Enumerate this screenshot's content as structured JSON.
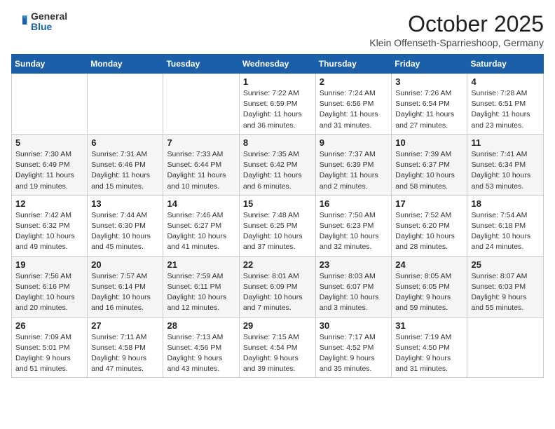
{
  "header": {
    "logo_general": "General",
    "logo_blue": "Blue",
    "month_title": "October 2025",
    "subtitle": "Klein Offenseth-Sparrieshoop, Germany"
  },
  "weekdays": [
    "Sunday",
    "Monday",
    "Tuesday",
    "Wednesday",
    "Thursday",
    "Friday",
    "Saturday"
  ],
  "weeks": [
    [
      {
        "day": "",
        "info": ""
      },
      {
        "day": "",
        "info": ""
      },
      {
        "day": "",
        "info": ""
      },
      {
        "day": "1",
        "info": "Sunrise: 7:22 AM\nSunset: 6:59 PM\nDaylight: 11 hours\nand 36 minutes."
      },
      {
        "day": "2",
        "info": "Sunrise: 7:24 AM\nSunset: 6:56 PM\nDaylight: 11 hours\nand 31 minutes."
      },
      {
        "day": "3",
        "info": "Sunrise: 7:26 AM\nSunset: 6:54 PM\nDaylight: 11 hours\nand 27 minutes."
      },
      {
        "day": "4",
        "info": "Sunrise: 7:28 AM\nSunset: 6:51 PM\nDaylight: 11 hours\nand 23 minutes."
      }
    ],
    [
      {
        "day": "5",
        "info": "Sunrise: 7:30 AM\nSunset: 6:49 PM\nDaylight: 11 hours\nand 19 minutes."
      },
      {
        "day": "6",
        "info": "Sunrise: 7:31 AM\nSunset: 6:46 PM\nDaylight: 11 hours\nand 15 minutes."
      },
      {
        "day": "7",
        "info": "Sunrise: 7:33 AM\nSunset: 6:44 PM\nDaylight: 11 hours\nand 10 minutes."
      },
      {
        "day": "8",
        "info": "Sunrise: 7:35 AM\nSunset: 6:42 PM\nDaylight: 11 hours\nand 6 minutes."
      },
      {
        "day": "9",
        "info": "Sunrise: 7:37 AM\nSunset: 6:39 PM\nDaylight: 11 hours\nand 2 minutes."
      },
      {
        "day": "10",
        "info": "Sunrise: 7:39 AM\nSunset: 6:37 PM\nDaylight: 10 hours\nand 58 minutes."
      },
      {
        "day": "11",
        "info": "Sunrise: 7:41 AM\nSunset: 6:34 PM\nDaylight: 10 hours\nand 53 minutes."
      }
    ],
    [
      {
        "day": "12",
        "info": "Sunrise: 7:42 AM\nSunset: 6:32 PM\nDaylight: 10 hours\nand 49 minutes."
      },
      {
        "day": "13",
        "info": "Sunrise: 7:44 AM\nSunset: 6:30 PM\nDaylight: 10 hours\nand 45 minutes."
      },
      {
        "day": "14",
        "info": "Sunrise: 7:46 AM\nSunset: 6:27 PM\nDaylight: 10 hours\nand 41 minutes."
      },
      {
        "day": "15",
        "info": "Sunrise: 7:48 AM\nSunset: 6:25 PM\nDaylight: 10 hours\nand 37 minutes."
      },
      {
        "day": "16",
        "info": "Sunrise: 7:50 AM\nSunset: 6:23 PM\nDaylight: 10 hours\nand 32 minutes."
      },
      {
        "day": "17",
        "info": "Sunrise: 7:52 AM\nSunset: 6:20 PM\nDaylight: 10 hours\nand 28 minutes."
      },
      {
        "day": "18",
        "info": "Sunrise: 7:54 AM\nSunset: 6:18 PM\nDaylight: 10 hours\nand 24 minutes."
      }
    ],
    [
      {
        "day": "19",
        "info": "Sunrise: 7:56 AM\nSunset: 6:16 PM\nDaylight: 10 hours\nand 20 minutes."
      },
      {
        "day": "20",
        "info": "Sunrise: 7:57 AM\nSunset: 6:14 PM\nDaylight: 10 hours\nand 16 minutes."
      },
      {
        "day": "21",
        "info": "Sunrise: 7:59 AM\nSunset: 6:11 PM\nDaylight: 10 hours\nand 12 minutes."
      },
      {
        "day": "22",
        "info": "Sunrise: 8:01 AM\nSunset: 6:09 PM\nDaylight: 10 hours\nand 7 minutes."
      },
      {
        "day": "23",
        "info": "Sunrise: 8:03 AM\nSunset: 6:07 PM\nDaylight: 10 hours\nand 3 minutes."
      },
      {
        "day": "24",
        "info": "Sunrise: 8:05 AM\nSunset: 6:05 PM\nDaylight: 9 hours\nand 59 minutes."
      },
      {
        "day": "25",
        "info": "Sunrise: 8:07 AM\nSunset: 6:03 PM\nDaylight: 9 hours\nand 55 minutes."
      }
    ],
    [
      {
        "day": "26",
        "info": "Sunrise: 7:09 AM\nSunset: 5:01 PM\nDaylight: 9 hours\nand 51 minutes."
      },
      {
        "day": "27",
        "info": "Sunrise: 7:11 AM\nSunset: 4:58 PM\nDaylight: 9 hours\nand 47 minutes."
      },
      {
        "day": "28",
        "info": "Sunrise: 7:13 AM\nSunset: 4:56 PM\nDaylight: 9 hours\nand 43 minutes."
      },
      {
        "day": "29",
        "info": "Sunrise: 7:15 AM\nSunset: 4:54 PM\nDaylight: 9 hours\nand 39 minutes."
      },
      {
        "day": "30",
        "info": "Sunrise: 7:17 AM\nSunset: 4:52 PM\nDaylight: 9 hours\nand 35 minutes."
      },
      {
        "day": "31",
        "info": "Sunrise: 7:19 AM\nSunset: 4:50 PM\nDaylight: 9 hours\nand 31 minutes."
      },
      {
        "day": "",
        "info": ""
      }
    ]
  ]
}
